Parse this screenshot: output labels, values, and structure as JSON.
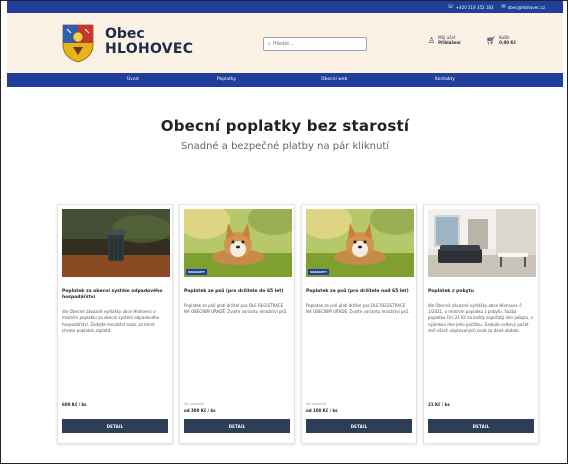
{
  "topbar": {
    "phone": "+420 519 352 183",
    "email": "obec@hlohovec.cz",
    "phone_icon": "phone-icon",
    "email_icon": "mail-icon"
  },
  "brand": {
    "line1": "Obec",
    "line2": "HLOHOVEC"
  },
  "search": {
    "placeholder": "Hledat..."
  },
  "account": {
    "label": "Můj účet",
    "action": "Přihlášení"
  },
  "cart": {
    "label": "Košík",
    "value": "0,00 Kč"
  },
  "nav": [
    "Úvod",
    "Poplatky",
    "Obecní web",
    "Kontakty"
  ],
  "hero": {
    "title": "Obecní poplatky bez starostí",
    "subtitle": "Snadné a bezpečné platby na pár kliknutí"
  },
  "cards": [
    {
      "title": "Poplatek za obecní systém odpadového hospodářství",
      "desc": "dle Obecně závazné vyhlášky obce Hlohovec o místním poplatku za obecní systém odpadového hospodářství. Zadejte množství osob, za které chcete poplatek zaplatit.",
      "badge": "",
      "price_note": "",
      "price": "600 Kč / ks",
      "button": "DETAIL",
      "image": "bin-photo"
    },
    {
      "title": "Poplatek ze psů (pro držitele do 65 let)",
      "desc": "Poplatek ze psů platí držitel psa DLE REGISTRACE NA OBECNÍM ÚŘADĚ. Zvolte variantu množství psů.",
      "badge": "VARIANTY",
      "price_note": "Ve variantě",
      "price": "od 300 Kč / ks",
      "button": "DETAIL",
      "image": "dog-photo"
    },
    {
      "title": "Poplatek ze psů (pro držitele nad 65 let)",
      "desc": "Poplatek ze psů platí držitel psa DLE REGISTRACE NA OBECNÍM ÚŘADĚ. Zvolte variantu množství psů.",
      "badge": "VARIANTY",
      "price_note": "Ve variantě",
      "price": "od 100 Kč / ks",
      "button": "DETAIL",
      "image": "dog-photo"
    },
    {
      "title": "Poplatek z pobytu",
      "desc": "dle Obecně závazné vyhlášky obce Hlohovec č. 1/2021, o místním poplatku z pobytu. Sazba poplatku činí 21 Kč za každý započatý den pobytu, s výjimkou dne jeho počátku. Zadejte celkový počet dnů všech ubytovaných osob za dané období.",
      "badge": "",
      "price_note": "",
      "price": "21 Kč / ks",
      "button": "DETAIL",
      "image": "room-photo"
    }
  ]
}
